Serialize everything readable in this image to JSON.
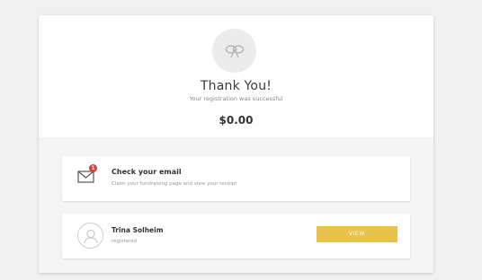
{
  "confirmation": {
    "logo_icon": "ribbon-logo-icon",
    "title": "Thank You!",
    "subtitle": "Your registration was successful",
    "amount": "$0.00"
  },
  "email_panel": {
    "icon": "envelope-icon",
    "badge_count": "1",
    "title": "Check your email",
    "description": "Claim your fundraising page and view your receipt"
  },
  "user_panel": {
    "avatar_icon": "user-avatar-icon",
    "name": "Trina Solheim",
    "status": "registered",
    "view_label": "VIEW"
  },
  "colors": {
    "accent": "#e8c24a",
    "badge": "#d9403a",
    "background": "#f1f1f1"
  }
}
